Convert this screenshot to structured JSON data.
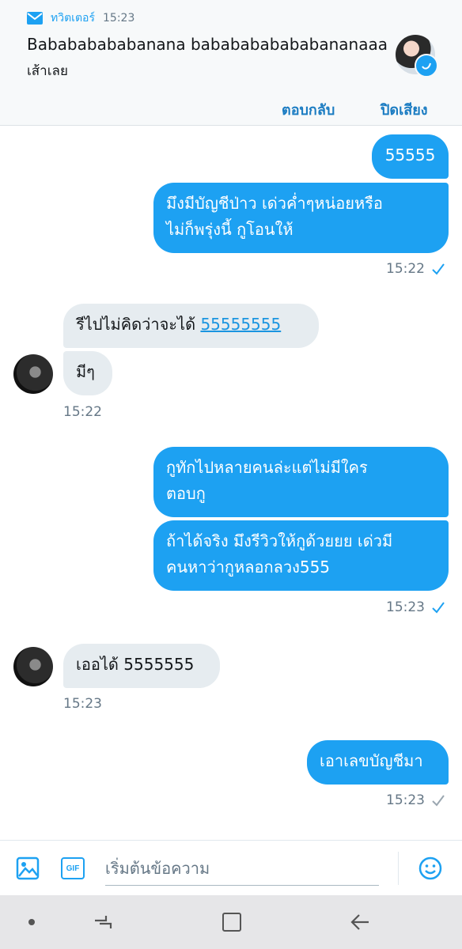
{
  "notification": {
    "app_name": "ทวิตเตอร์",
    "time": "15:23",
    "title": "Babababababanana bababababababananaaa",
    "body": "เส้าเลย",
    "actions": {
      "reply": "ตอบกลับ",
      "mute": "ปิดเสียง"
    }
  },
  "messages": [
    {
      "direction": "outgoing",
      "text": "55555"
    },
    {
      "direction": "outgoing",
      "text_lines": [
        "มึงมีบัญชีป่าว เด่วค่ำๆหน่อยหรือ",
        "ไม่ก็พรุ่งนี้ กูโอนให้"
      ]
    },
    {
      "direction": "meta",
      "time": "15:22",
      "status": "read"
    },
    {
      "direction": "incoming",
      "text": "รีไปไม่คิดว่าจะได้ ",
      "link": "55555555"
    },
    {
      "direction": "incoming",
      "text": "มีๆ"
    },
    {
      "direction": "meta",
      "time": "15:22"
    },
    {
      "direction": "outgoing",
      "text_lines": [
        "กูทักไปหลายคนล่ะแต่ไม่มีใคร",
        "ตอบกู"
      ]
    },
    {
      "direction": "outgoing",
      "text_lines": [
        "ถ้าได้จริง มึงรีวิวให้กูด้วยยย เด่วมี",
        "คนหาว่ากูหลอกลวง555"
      ]
    },
    {
      "direction": "meta",
      "time": "15:23",
      "status": "read"
    },
    {
      "direction": "incoming",
      "text": "เออได้ 5555555"
    },
    {
      "direction": "meta",
      "time": "15:23"
    },
    {
      "direction": "outgoing",
      "text": "เอาเลขบัญชีมา"
    },
    {
      "direction": "meta",
      "time": "15:23",
      "status": "sent"
    }
  ],
  "compose": {
    "placeholder": "เริ่มต้นข้อความ",
    "gif_label": "GIF",
    "icons": [
      "image-icon",
      "gif-icon",
      "emoji-icon"
    ]
  },
  "navbar": {
    "icons": [
      "dot-icon",
      "recents-icon",
      "home-icon",
      "back-icon"
    ]
  },
  "colors": {
    "accent": "#1da1f2",
    "incoming_bubble": "#e6ecf0",
    "meta_text": "#657786"
  }
}
